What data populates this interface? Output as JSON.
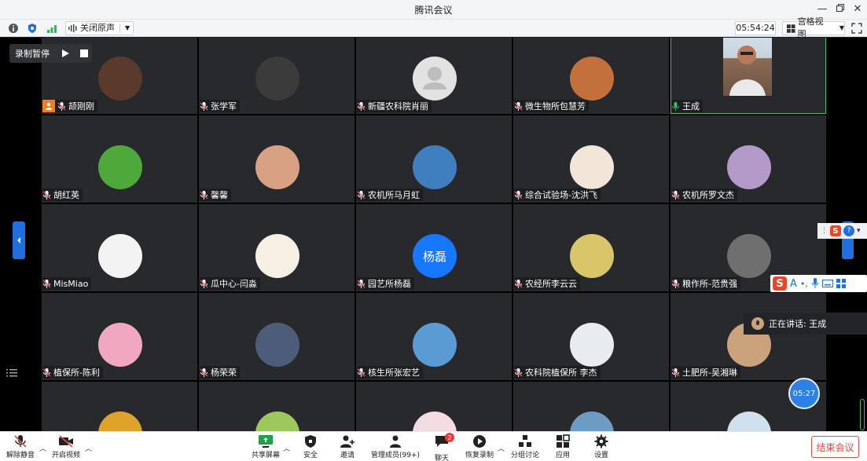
{
  "window": {
    "title": "腾讯会议",
    "controls": [
      "minimize-icon",
      "restore-icon",
      "close-icon"
    ]
  },
  "infobar": {
    "audio_toggle_label": "关闭原声",
    "timer": "05:54:24",
    "view_label": "宫格视图"
  },
  "recording": {
    "label": "录制暂停"
  },
  "participants": [
    {
      "name": "颉刚刚",
      "mic": "muted",
      "host": true,
      "avatar_color": "#5a3a2a"
    },
    {
      "name": "张学军",
      "mic": "muted",
      "avatar_color": "#3b3b3b"
    },
    {
      "name": "新疆农科院肖丽",
      "mic": "muted",
      "avatar_color": "#e2e2e2"
    },
    {
      "name": "微生物所包慧芳",
      "mic": "muted",
      "avatar_color": "#c4703c"
    },
    {
      "name": "王成",
      "mic": "active",
      "camera": true
    },
    {
      "name": "胡红英",
      "mic": "muted",
      "avatar_color": "#4fa83a"
    },
    {
      "name": "馨馨",
      "mic": "muted",
      "avatar_color": "#d9a184"
    },
    {
      "name": "农机所马月虹",
      "mic": "muted",
      "avatar_color": "#3f7fbf"
    },
    {
      "name": "综合试验场-沈洪飞",
      "mic": "muted",
      "avatar_color": "#f2e6d8"
    },
    {
      "name": "农机所罗文杰",
      "mic": "muted",
      "avatar_color": "#b49ac8"
    },
    {
      "name": "MisMiao",
      "mic": "muted",
      "avatar_color": "#f3f3f3"
    },
    {
      "name": "瓜中心-闫淼",
      "mic": "muted",
      "avatar_color": "#f6efe4"
    },
    {
      "name": "园艺所杨磊",
      "mic": "muted",
      "avatar_color": "#1677ff",
      "initials": "杨磊"
    },
    {
      "name": "农经所李云云",
      "mic": "muted",
      "avatar_color": "#d9c56a"
    },
    {
      "name": "粮作所-范贵强",
      "mic": "muted",
      "avatar_color": "#6f6f6f"
    },
    {
      "name": "植保所-陈利",
      "mic": "muted",
      "avatar_color": "#f2a7c1"
    },
    {
      "name": "杨荣荣",
      "mic": "muted",
      "avatar_color": "#4d5c78"
    },
    {
      "name": "核生所张宏艺",
      "mic": "muted",
      "avatar_color": "#5a9bd4"
    },
    {
      "name": "农科院植保所 李杰",
      "mic": "muted",
      "avatar_color": "#e8ecef"
    },
    {
      "name": "土肥所-吴湘琳",
      "mic": "muted",
      "avatar_color": "#caa27c"
    },
    {
      "name": "",
      "mic": "muted",
      "avatar_color": "#e0a32a"
    },
    {
      "name": "",
      "mic": "muted",
      "avatar_color": "#9cc95c"
    },
    {
      "name": "",
      "mic": "muted",
      "avatar_color": "#f3dce2"
    },
    {
      "name": "",
      "mic": "muted",
      "avatar_color": "#6d9bc3"
    },
    {
      "name": "",
      "mic": "muted",
      "avatar_color": "#cfe0ef"
    }
  ],
  "speaking_now": "正在讲话: 王成",
  "pip_time": "05:27",
  "toolbar": {
    "unmute": "解除静音",
    "start_video": "开启视频",
    "share_screen": "共享屏幕",
    "security": "安全",
    "invite": "邀请",
    "manage_members": "管理成员(99+)",
    "chat": "聊天",
    "chat_badge": "2",
    "resume_recording": "恢复录制",
    "breakout": "分组讨论",
    "apps": "应用",
    "settings": "设置",
    "end_meeting": "结束会议"
  },
  "colors": {
    "accent": "#1677ff",
    "danger": "#e84b4b",
    "active_speaker": "#3fbf5f"
  }
}
